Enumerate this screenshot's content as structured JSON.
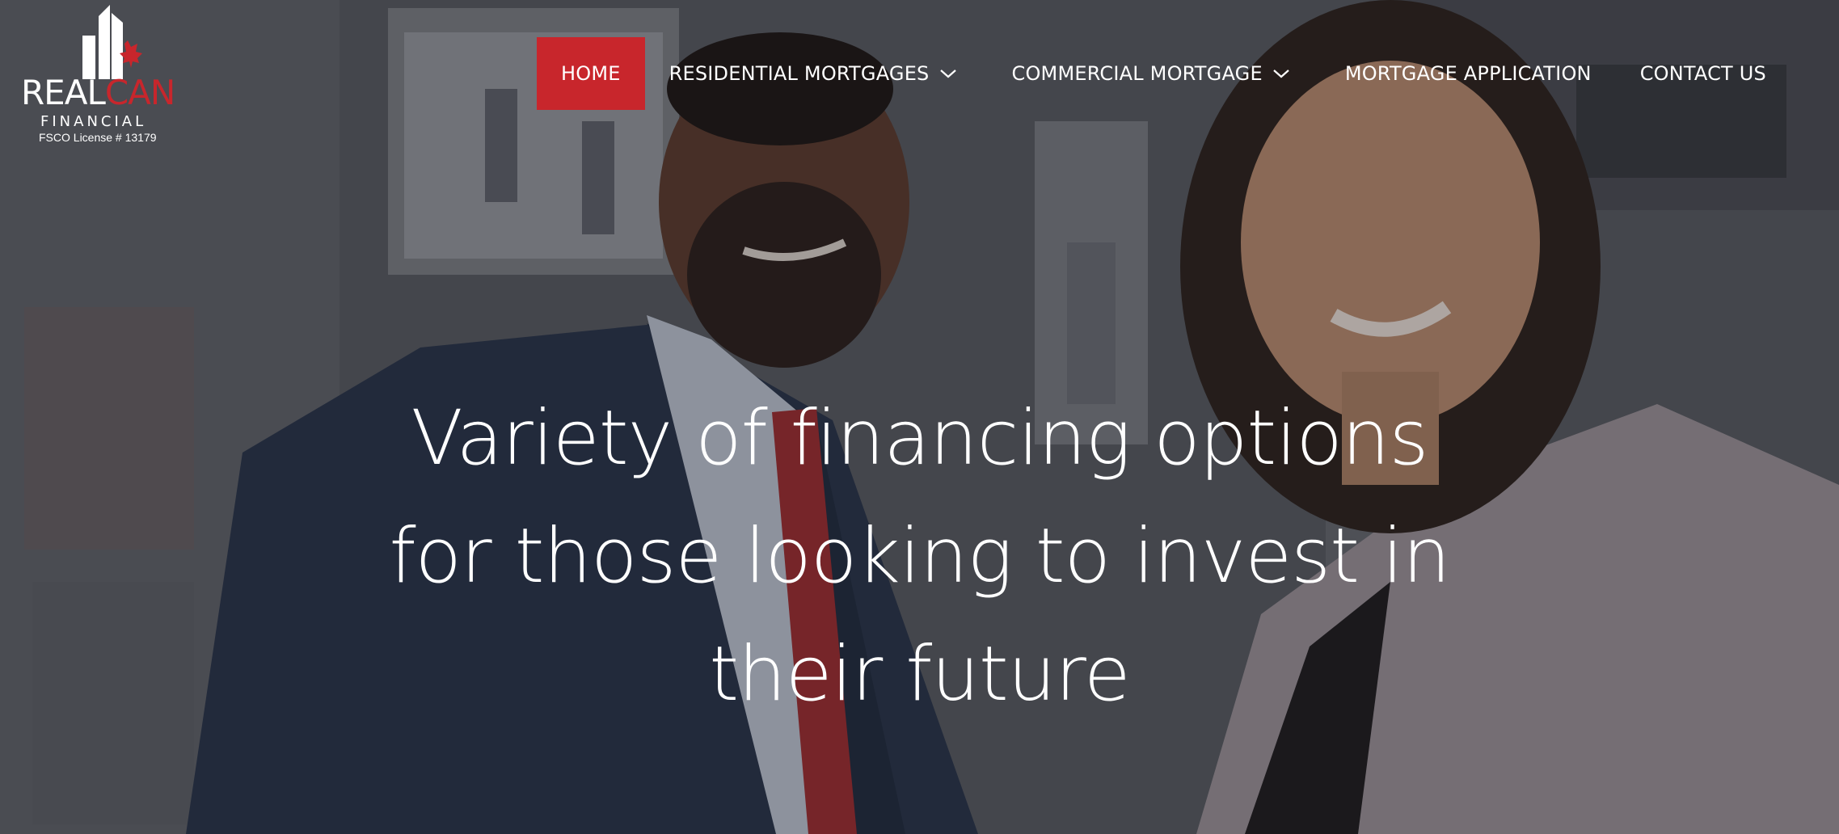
{
  "brand": {
    "word_part1": "REAL",
    "word_part2": "CAN",
    "subtitle": "FINANCIAL",
    "license": "FSCO License # 13179",
    "accent_color": "#c8262c"
  },
  "nav": {
    "items": [
      {
        "label": "HOME",
        "active": true
      },
      {
        "label": "RESIDENTIAL MORTGAGES",
        "has_dropdown": true,
        "icon": "chevron-down-icon"
      },
      {
        "label": "COMMERCIAL MORTGAGE",
        "has_dropdown": true,
        "icon": "chevron-down-icon"
      },
      {
        "label": "MORTGAGE APPLICATION"
      },
      {
        "label": "CONTACT US"
      }
    ]
  },
  "hero": {
    "headline_lines": [
      "Variety of financing options",
      "for those looking to invest in",
      "their future"
    ]
  }
}
